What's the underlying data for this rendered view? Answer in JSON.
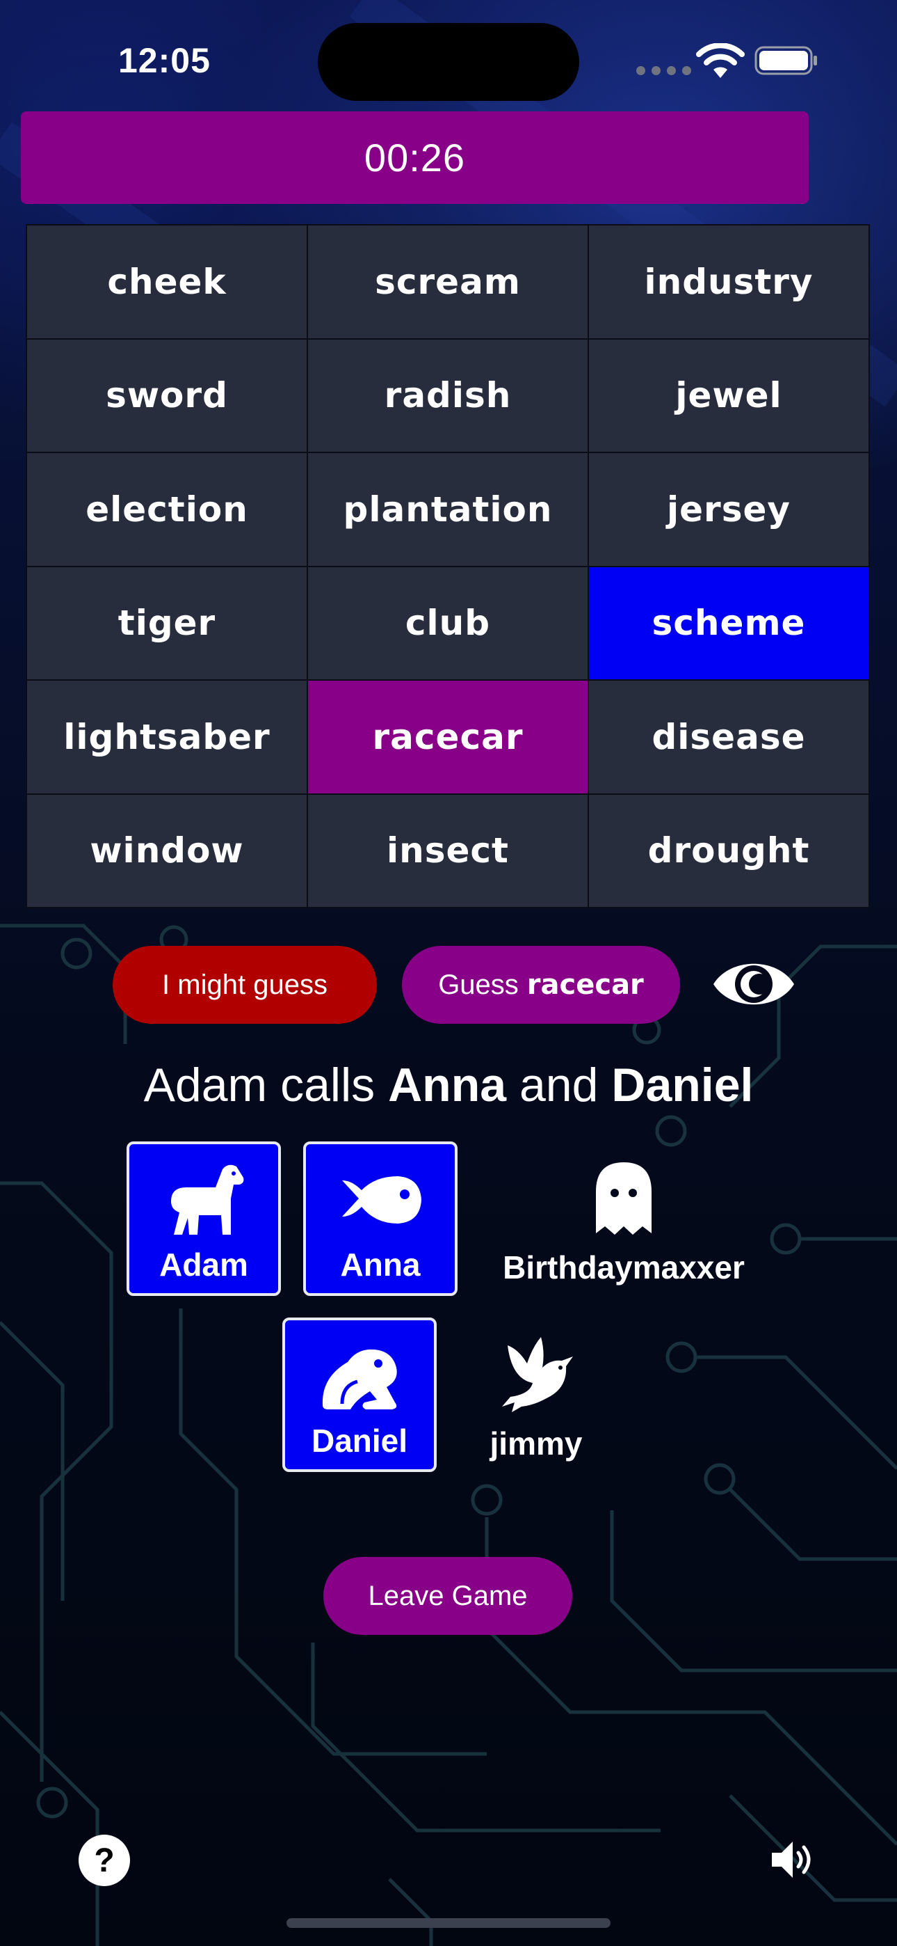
{
  "status_bar": {
    "time": "12:05"
  },
  "timer": {
    "value": "00:26"
  },
  "grid": {
    "words": [
      {
        "text": "cheek",
        "color": "none"
      },
      {
        "text": "scream",
        "color": "none"
      },
      {
        "text": "industry",
        "color": "none"
      },
      {
        "text": "sword",
        "color": "none"
      },
      {
        "text": "radish",
        "color": "none"
      },
      {
        "text": "jewel",
        "color": "none"
      },
      {
        "text": "election",
        "color": "none"
      },
      {
        "text": "plantation",
        "color": "none"
      },
      {
        "text": "jersey",
        "color": "none"
      },
      {
        "text": "tiger",
        "color": "none"
      },
      {
        "text": "club",
        "color": "none"
      },
      {
        "text": "scheme",
        "color": "blue"
      },
      {
        "text": "lightsaber",
        "color": "none"
      },
      {
        "text": "racecar",
        "color": "purple"
      },
      {
        "text": "disease",
        "color": "none"
      },
      {
        "text": "window",
        "color": "none"
      },
      {
        "text": "insect",
        "color": "none"
      },
      {
        "text": "drought",
        "color": "none"
      }
    ]
  },
  "actions": {
    "might_guess_label": "I might guess",
    "guess_prefix": "Guess",
    "guess_word": "racecar"
  },
  "call": {
    "caller": "Adam",
    "calls_word": "calls",
    "first": "Anna",
    "and_word": "and",
    "second": "Daniel"
  },
  "players": [
    {
      "name": "Adam",
      "icon": "horse-icon",
      "highlighted": true
    },
    {
      "name": "Anna",
      "icon": "fish-icon",
      "highlighted": true
    },
    {
      "name": "Birthdaymaxxer",
      "icon": "ghost-icon",
      "highlighted": false
    },
    {
      "name": "Daniel",
      "icon": "frog-icon",
      "highlighted": true
    },
    {
      "name": "jimmy",
      "icon": "dove-icon",
      "highlighted": false
    }
  ],
  "leave_label": "Leave Game",
  "help_label": "?",
  "colors": {
    "purple": "#870087",
    "blue": "#0000f5",
    "red": "#b00000"
  }
}
